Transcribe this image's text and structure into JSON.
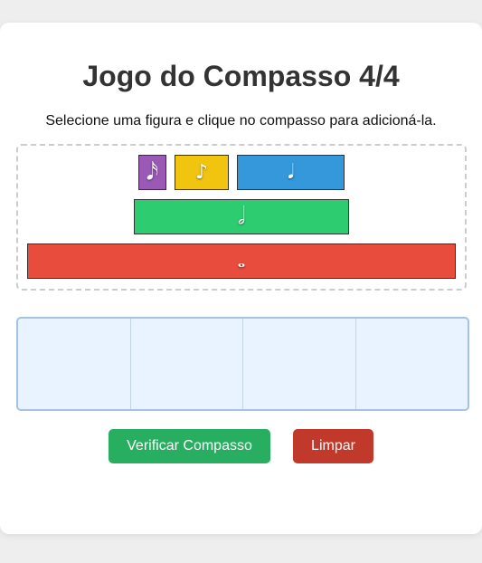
{
  "title": "Jogo do Compasso 4/4",
  "instructions": "Selecione uma figura e clique no compasso para adicioná-la.",
  "palette": {
    "notes": [
      {
        "name": "semicolcheia",
        "symbol": "𝅘𝅥𝅯",
        "color": "#9b59b6",
        "duration_beats": 0.25
      },
      {
        "name": "colcheia",
        "symbol": "♪",
        "color": "#f1c40f",
        "duration_beats": 0.5
      },
      {
        "name": "seminima",
        "symbol": "𝅘𝅥",
        "color": "#3498db",
        "duration_beats": 1
      },
      {
        "name": "minima",
        "symbol": "𝅗𝅥",
        "color": "#2ecc71",
        "duration_beats": 2
      },
      {
        "name": "semibreve",
        "symbol": "𝅝",
        "color": "#e74c3c",
        "duration_beats": 4
      }
    ]
  },
  "measure": {
    "beats": 4,
    "slots": [
      "",
      "",
      "",
      ""
    ]
  },
  "buttons": {
    "verify_label": "Verificar Compasso",
    "clear_label": "Limpar"
  },
  "colors": {
    "verify": "#27ae60",
    "clear": "#c0392b",
    "measure_bg": "#e8f3ff"
  }
}
